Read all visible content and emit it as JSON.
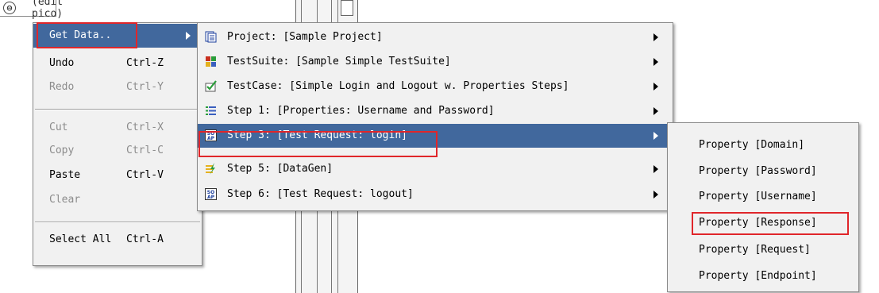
{
  "background": {
    "editor_text": "(edit pico)"
  },
  "menu1": {
    "items": [
      {
        "label": "Get Data..",
        "shortcut": "",
        "submenu": true,
        "selected": true,
        "disabled": false
      },
      {
        "label": "Undo",
        "shortcut": "Ctrl-Z",
        "disabled": false
      },
      {
        "label": "Redo",
        "shortcut": "Ctrl-Y",
        "disabled": true
      },
      {
        "label": "Cut",
        "shortcut": "Ctrl-X",
        "disabled": true
      },
      {
        "label": "Copy",
        "shortcut": "Ctrl-C",
        "disabled": true
      },
      {
        "label": "Paste",
        "shortcut": "Ctrl-V",
        "disabled": false
      },
      {
        "label": "Clear",
        "shortcut": "",
        "disabled": true
      },
      {
        "label": "Select All",
        "shortcut": "Ctrl-A",
        "disabled": false
      }
    ]
  },
  "menu2": {
    "items": [
      {
        "label": "Project: [Sample Project]",
        "icon": "project-icon"
      },
      {
        "label": "TestSuite: [Sample Simple TestSuite]",
        "icon": "testsuite-icon"
      },
      {
        "label": "TestCase: [Simple Login and Logout w. Properties Steps]",
        "icon": "testcase-icon"
      },
      {
        "label": "Step 1: [Properties: Username and Password]",
        "icon": "properties-step-icon"
      },
      {
        "label": "Step 3: [Test Request: login]",
        "icon": "soap-request-icon",
        "selected": true
      },
      {
        "label": "Step 5: [DataGen]",
        "icon": "datagen-icon"
      },
      {
        "label": "Step 6: [Test Request: logout]",
        "icon": "soap-request-icon"
      }
    ]
  },
  "menu3": {
    "items": [
      {
        "label": "Property [Domain]"
      },
      {
        "label": "Property [Password]"
      },
      {
        "label": "Property [Username]"
      },
      {
        "label": "Property [Response]",
        "highlighted": true
      },
      {
        "label": "Property [Request]"
      },
      {
        "label": "Property [Endpoint]"
      }
    ]
  },
  "colors": {
    "selection": "#41689d",
    "highlight_box": "#e0262a"
  }
}
